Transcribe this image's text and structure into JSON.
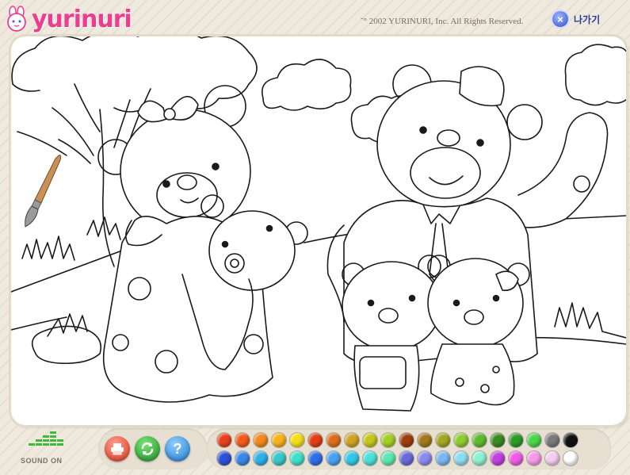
{
  "header": {
    "logo_text": "yurinuri",
    "copyright": "ˇ° 2002 YURINURI, Inc. All Rights Reserved.",
    "exit_label": "나가기"
  },
  "tools": {
    "sound_label": "SOUND ON",
    "help_glyph": "?"
  },
  "palette": {
    "row1": [
      "#e8401e",
      "#f25a1c",
      "#f4891a",
      "#f6b21a",
      "#f5dd16",
      "#e23d15",
      "#dd6d1c",
      "#cfa324",
      "#c4c61c",
      "#a3cf24",
      "#9c3d10",
      "#a2781a",
      "#a2a620",
      "#8ecc30",
      "#5fba2e",
      "#3a8a22",
      "#2e9a2a",
      "#4bd64b",
      "#7a7a7a",
      "#111111"
    ],
    "row2": [
      "#2f4fd8",
      "#3a86e8",
      "#2fb0e8",
      "#38c8c8",
      "#3fe0c8",
      "#2f6fe8",
      "#4aa0f0",
      "#30c8e8",
      "#4ce0d8",
      "#5ce8b0",
      "#6a6ad8",
      "#8a8af0",
      "#7ab8f0",
      "#8cdcf0",
      "#8ef0d0",
      "#c040e0",
      "#f05ae8",
      "#f59ae8",
      "#f6ccf0",
      "#ffffff"
    ]
  }
}
